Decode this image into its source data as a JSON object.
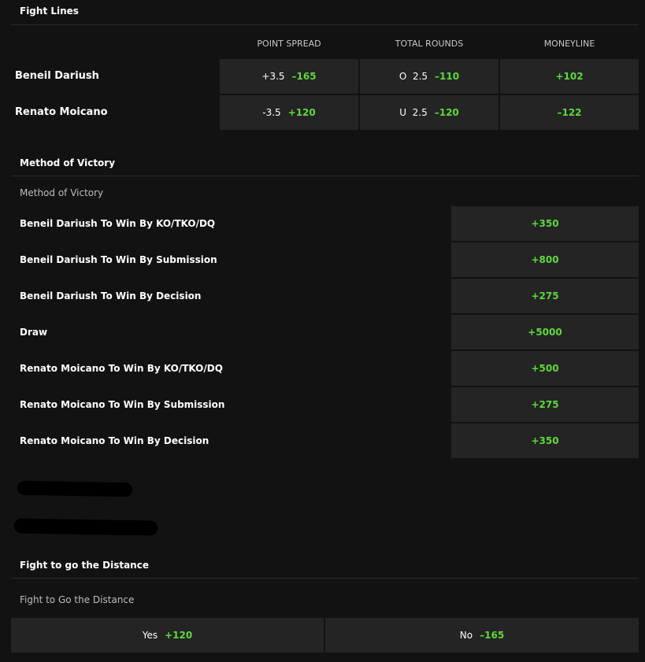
{
  "fight_lines": {
    "title": "Fight Lines",
    "columns": [
      "POINT SPREAD",
      "TOTAL ROUNDS",
      "MONEYLINE"
    ],
    "rows": [
      {
        "fighter": "Beneil Dariush",
        "spread_line": "+3.5",
        "spread_odds": "–165",
        "total_line": "O  2.5",
        "total_odds": "–110",
        "moneyline": "+102"
      },
      {
        "fighter": "Renato Moicano",
        "spread_line": "-3.5",
        "spread_odds": "+120",
        "total_line": "U  2.5",
        "total_odds": "–120",
        "moneyline": "–122"
      }
    ]
  },
  "method_of_victory": {
    "title": "Method of Victory",
    "subtitle": "Method of Victory",
    "items": [
      {
        "label": "Beneil Dariush To Win By KO/TKO/DQ",
        "odds": "+350"
      },
      {
        "label": "Beneil Dariush To Win By Submission",
        "odds": "+800"
      },
      {
        "label": "Beneil Dariush To Win By Decision",
        "odds": "+275"
      },
      {
        "label": "Draw",
        "odds": "+5000"
      },
      {
        "label": "Renato Moicano To Win By KO/TKO/DQ",
        "odds": "+500"
      },
      {
        "label": "Renato Moicano To Win By Submission",
        "odds": "+275"
      },
      {
        "label": "Renato Moicano To Win By Decision",
        "odds": "+350"
      }
    ]
  },
  "distance": {
    "title": "Fight to go the Distance",
    "subtitle": "Fight to Go the Distance",
    "options": [
      {
        "label": "Yes",
        "odds": "+120"
      },
      {
        "label": "No",
        "odds": "–165"
      }
    ]
  },
  "colors": {
    "background": "#121212",
    "cell": "#242424",
    "odds_green": "#5ed93a",
    "divider": "#2a2a2a"
  }
}
